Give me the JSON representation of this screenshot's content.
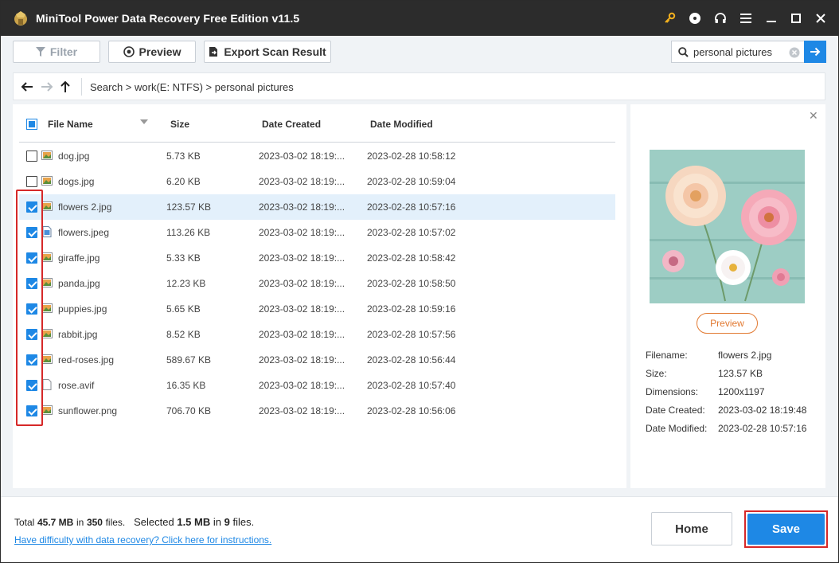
{
  "app": {
    "title": "MiniTool Power Data Recovery Free Edition v11.5",
    "icons": [
      "key-icon",
      "disc-icon",
      "headset-icon",
      "menu-icon",
      "minimize-icon",
      "maximize-icon",
      "close-icon"
    ],
    "accent_color": "#1e88e5",
    "titlebar_color": "#2c2c2c"
  },
  "toolbar": {
    "filter_label": "Filter",
    "preview_label": "Preview",
    "export_label": "Export Scan Result",
    "search_value": "personal pictures"
  },
  "path": {
    "text": "Search > work(E: NTFS) > personal pictures"
  },
  "table": {
    "headers": {
      "name": "File Name",
      "size": "Size",
      "created": "Date Created",
      "modified": "Date Modified"
    },
    "rows": [
      {
        "checked": false,
        "name": "dog.jpg",
        "size": "5.73 KB",
        "created": "2023-03-02 18:19:...",
        "modified": "2023-02-28 10:58:12",
        "icon": "image-file-icon"
      },
      {
        "checked": false,
        "name": "dogs.jpg",
        "size": "6.20 KB",
        "created": "2023-03-02 18:19:...",
        "modified": "2023-02-28 10:59:04",
        "icon": "image-file-icon"
      },
      {
        "checked": true,
        "name": "flowers 2.jpg",
        "size": "123.57 KB",
        "created": "2023-03-02 18:19:...",
        "modified": "2023-02-28 10:57:16",
        "icon": "image-file-icon",
        "selected": true
      },
      {
        "checked": true,
        "name": "flowers.jpeg",
        "size": "113.26 KB",
        "created": "2023-03-02 18:19:...",
        "modified": "2023-02-28 10:57:02",
        "icon": "jpeg-file-icon"
      },
      {
        "checked": true,
        "name": "giraffe.jpg",
        "size": "5.33 KB",
        "created": "2023-03-02 18:19:...",
        "modified": "2023-02-28 10:58:42",
        "icon": "image-file-icon"
      },
      {
        "checked": true,
        "name": "panda.jpg",
        "size": "12.23 KB",
        "created": "2023-03-02 18:19:...",
        "modified": "2023-02-28 10:58:50",
        "icon": "image-file-icon"
      },
      {
        "checked": true,
        "name": "puppies.jpg",
        "size": "5.65 KB",
        "created": "2023-03-02 18:19:...",
        "modified": "2023-02-28 10:59:16",
        "icon": "image-file-icon"
      },
      {
        "checked": true,
        "name": "rabbit.jpg",
        "size": "8.52 KB",
        "created": "2023-03-02 18:19:...",
        "modified": "2023-02-28 10:57:56",
        "icon": "image-file-icon"
      },
      {
        "checked": true,
        "name": "red-roses.jpg",
        "size": "589.67 KB",
        "created": "2023-03-02 18:19:...",
        "modified": "2023-02-28 10:56:44",
        "icon": "image-file-icon"
      },
      {
        "checked": true,
        "name": "rose.avif",
        "size": "16.35 KB",
        "created": "2023-03-02 18:19:...",
        "modified": "2023-02-28 10:57:40",
        "icon": "blank-file-icon"
      },
      {
        "checked": true,
        "name": "sunflower.png",
        "size": "706.70 KB",
        "created": "2023-03-02 18:19:...",
        "modified": "2023-02-28 10:56:06",
        "icon": "image-file-icon"
      }
    ]
  },
  "preview": {
    "button_label": "Preview",
    "meta": [
      {
        "key": "Filename:",
        "value": "flowers 2.jpg"
      },
      {
        "key": "Size:",
        "value": "123.57 KB"
      },
      {
        "key": "Dimensions:",
        "value": "1200x1197"
      },
      {
        "key": "Date Created:",
        "value": "2023-03-02 18:19:48"
      },
      {
        "key": "Date Modified:",
        "value": "2023-02-28 10:57:16"
      }
    ]
  },
  "footer": {
    "total_prefix": "Total",
    "total_size": "45.7 MB",
    "total_in": "in",
    "total_count": "350",
    "total_files": "files.",
    "selected_prefix": "Selected",
    "selected_size": "1.5 MB",
    "selected_in": "in",
    "selected_count": "9",
    "selected_files": "files.",
    "help_link": "Have difficulty with data recovery? Click here for instructions.",
    "home_label": "Home",
    "save_label": "Save"
  }
}
